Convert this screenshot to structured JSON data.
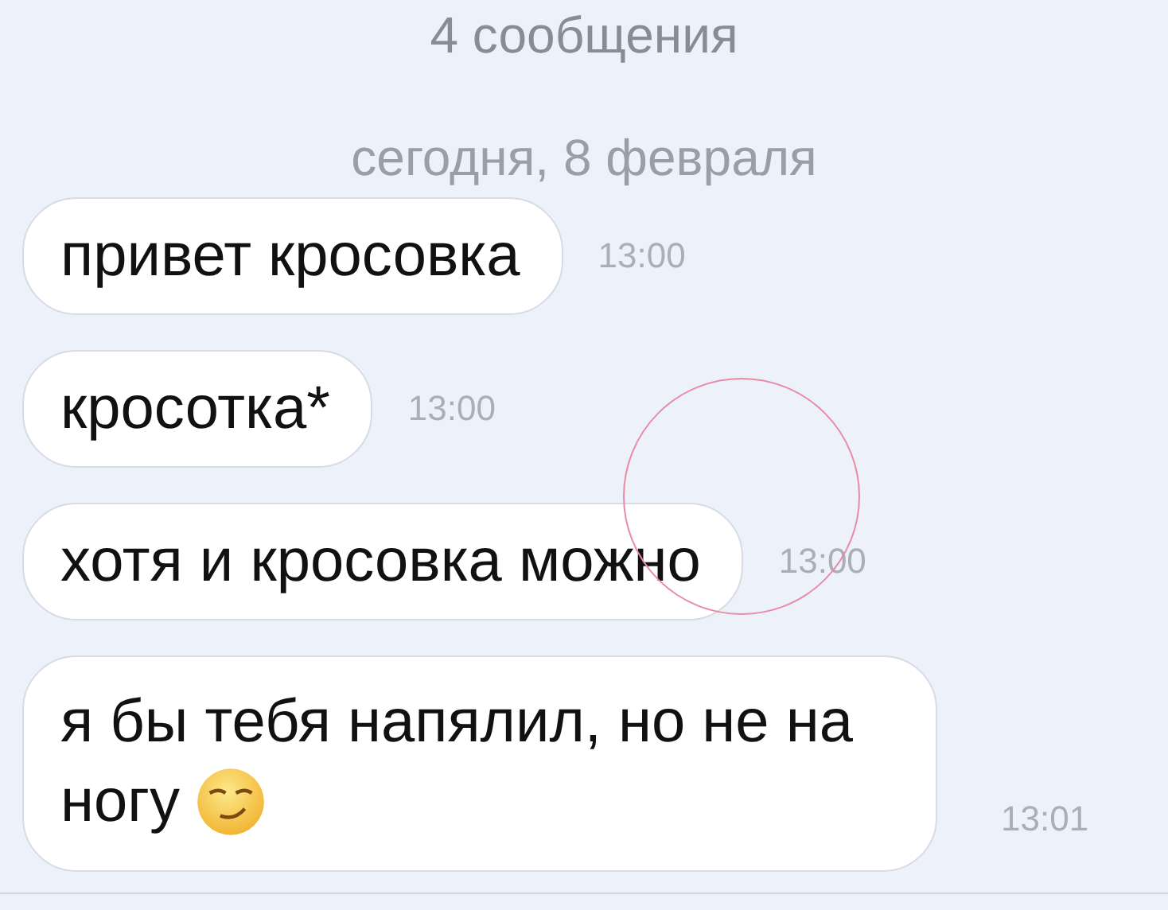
{
  "header": {
    "title": "4 сообщения"
  },
  "date_separator": "сегодня, 8 февраля",
  "messages": [
    {
      "lines": [
        "привет кросовка"
      ],
      "time": "13:00",
      "emoji": false
    },
    {
      "lines": [
        "кросотка*"
      ],
      "time": "13:00",
      "emoji": false
    },
    {
      "lines": [
        "хотя и кросовка можно"
      ],
      "time": "13:00",
      "emoji": false
    },
    {
      "lines": [
        "я бы тебя напялил, но не на",
        "ногу"
      ],
      "time": "13:01",
      "emoji": true
    }
  ]
}
